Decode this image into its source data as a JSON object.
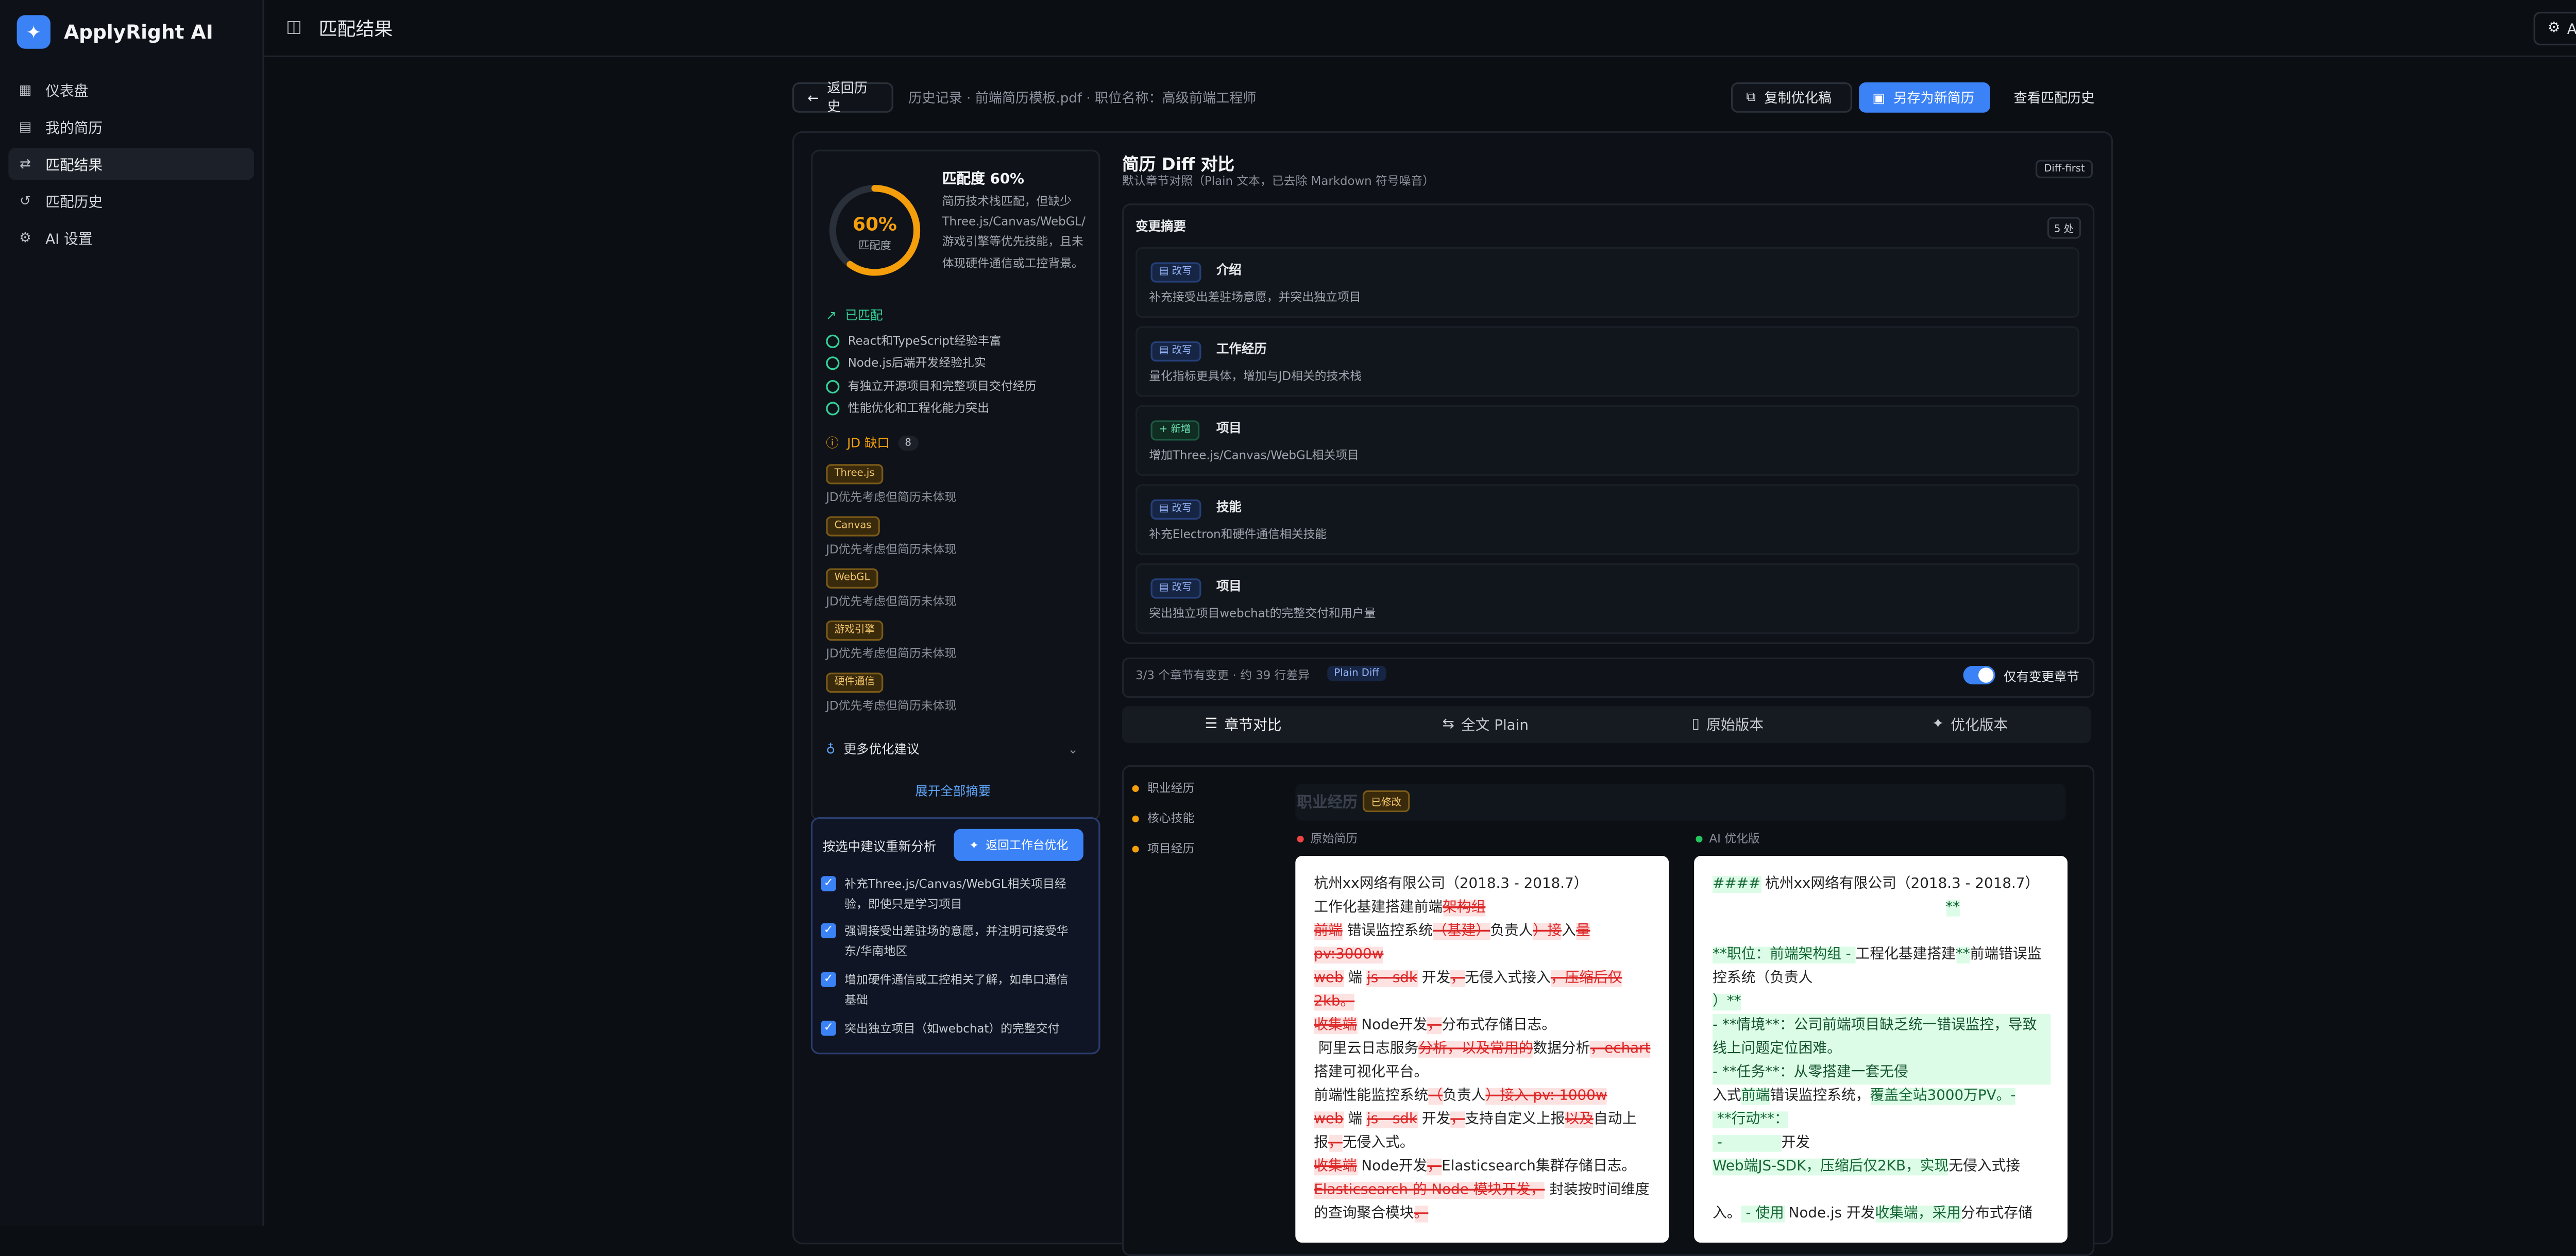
{
  "app": {
    "name": "ApplyRight AI"
  },
  "sidebar": {
    "items": [
      {
        "label": "仪表盘",
        "icon": "grid-icon"
      },
      {
        "label": "我的简历",
        "icon": "document-icon"
      },
      {
        "label": "匹配结果",
        "icon": "compare-icon",
        "active": true
      },
      {
        "label": "匹配历史",
        "icon": "history-icon"
      },
      {
        "label": "AI 设置",
        "icon": "gear-icon"
      }
    ]
  },
  "topbar": {
    "title": "匹配结果",
    "ai_settings": "AI 设置"
  },
  "header": {
    "back": "返回历史",
    "breadcrumb": "历史记录 · 前端简历模板.pdf · 职位名称：高级前端工程师",
    "copy": "复制优化稿",
    "save_new": "另存为新简历",
    "view_history": "查看匹配历史"
  },
  "score": {
    "percent_text": "60%",
    "percent_value": 60,
    "ring_label": "匹配度",
    "title": "匹配度 60%",
    "desc": "简历技术栈匹配，但缺少Three.js/Canvas/WebGL/游戏引擎等优先技能，且未体现硬件通信或工控背景。"
  },
  "matched": {
    "title": "已匹配",
    "items": [
      "React和TypeScript经验丰富",
      "Node.js后端开发经验扎实",
      "有独立开源项目和完整项目交付经历",
      "性能优化和工程化能力突出"
    ]
  },
  "gaps": {
    "title": "JD 缺口",
    "count": "8",
    "items": [
      {
        "tag": "Three.js",
        "desc": "JD优先考虑但简历未体现"
      },
      {
        "tag": "Canvas",
        "desc": "JD优先考虑但简历未体现"
      },
      {
        "tag": "WebGL",
        "desc": "JD优先考虑但简历未体现"
      },
      {
        "tag": "游戏引擎",
        "desc": "JD优先考虑但简历未体现"
      },
      {
        "tag": "硬件通信",
        "desc": "JD优先考虑但简历未体现"
      }
    ]
  },
  "more_suggestions": "更多优化建议",
  "expand_all": "展开全部摘要",
  "reanalyze": {
    "title": "按选中建议重新分析",
    "button": "返回工作台优化",
    "items": [
      "补充Three.js/Canvas/WebGL相关项目经验，即使只是学习项目",
      "强调接受出差驻场的意愿，并注明可接受华东/华南地区",
      "增加硬件通信或工控相关了解，如串口通信基础",
      "突出独立项目（如webchat）的完整交付"
    ]
  },
  "diff": {
    "title": "简历 Diff 对比",
    "subtitle": "默认章节对照（Plain 文本，已去除 Markdown 符号噪音）",
    "badge": "Diff-first",
    "changes_title": "变更摘要",
    "changes_count": "5 处",
    "changes": [
      {
        "type": "改写",
        "kind": "mod",
        "name": "介绍",
        "desc": "补充接受出差驻场意愿，并突出独立项目"
      },
      {
        "type": "改写",
        "kind": "mod",
        "name": "工作经历",
        "desc": "量化指标更具体，增加与JD相关的技术栈"
      },
      {
        "type": "新增",
        "kind": "new",
        "name": "项目",
        "desc": "增加Three.js/Canvas/WebGL相关项目"
      },
      {
        "type": "改写",
        "kind": "mod",
        "name": "技能",
        "desc": "补充Electron和硬件通信相关技能"
      },
      {
        "type": "改写",
        "kind": "mod",
        "name": "项目",
        "desc": "突出独立项目webchat的完整交付和用户量"
      }
    ],
    "stats": "3/3 个章节有变更 · 约 39 行差异",
    "stats_badge": "Plain Diff",
    "only_changed": "仅有变更章节",
    "tabs": [
      "章节对比",
      "全文 Plain",
      "原始版本",
      "优化版本"
    ],
    "sections": [
      "职业经历",
      "核心技能",
      "项目经历"
    ],
    "compare_title": "职业经历",
    "modified": "已修改",
    "original_label": "原始简历",
    "optimized_label": "AI 优化版"
  },
  "colors": {
    "accent": "#3b82f6",
    "success": "#34d399",
    "warning": "#f59e0b",
    "danger": "#dc2626"
  }
}
